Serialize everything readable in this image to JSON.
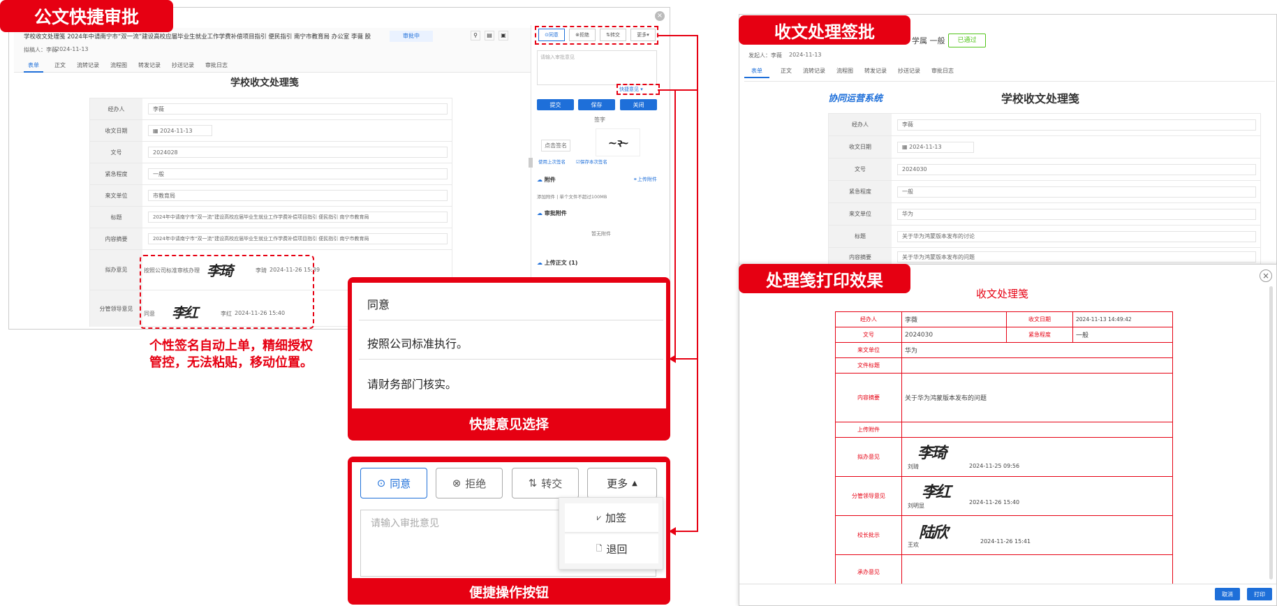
{
  "left": {
    "tag": "公文快捷审批",
    "header_title": "学校收文处理笺  2024年中请南宁市“双一流”建设高校应届毕业生就业工作学费补偿项目指引  便民指引  南宁市教育局  办公室  李薇  股",
    "status_badge": "审批中",
    "drafter_label": "拟稿人：李薇",
    "drafter_date": "2024-11-13",
    "tabs": [
      "表单",
      "正文",
      "流转记录",
      "流程图",
      "转发记录",
      "抄送记录",
      "审批日志"
    ],
    "form_title": "学校收文处理笺",
    "rows": [
      {
        "label": "经办人",
        "value": "李薇"
      },
      {
        "label": "收文日期",
        "value": "2024-11-13"
      },
      {
        "label": "文号",
        "value": "2024028"
      },
      {
        "label": "紧急程度",
        "value": "一般"
      },
      {
        "label": "来文单位",
        "value": "市教育局"
      },
      {
        "label": "标题",
        "value": "2024年中请南宁市“双一流”建设高校应届毕业生就业工作学费补偿项目指引  便民指引  南宁市教育局"
      },
      {
        "label": "内容摘要",
        "value": "2024年中请南宁市“双一流”建设高校应届毕业生就业工作学费补偿项目指引  便民指引  南宁市教育局"
      }
    ],
    "opinion1_label": "拟办意见",
    "opinion1_text": "按照公司标准审核办理",
    "opinion1_sig": "李琦",
    "opinion1_name": "李琦",
    "opinion1_time": "2024-11-26 15:39",
    "opinion2_label": "分管领导意见",
    "opinion2_text": "同意",
    "opinion2_sig": "李红",
    "opinion2_name": "李红",
    "opinion2_time": "2024-11-26 15:40",
    "side": {
      "btn_agree": "同意",
      "btn_reject": "拒绝",
      "btn_transfer": "转交",
      "btn_more": "更多",
      "opinion_placeholder": "请输入审批意见",
      "quick_opinion": "快捷意见",
      "btn_submit": "提交",
      "btn_save": "保存",
      "btn_close": "关闭",
      "sign_section": "签字",
      "sign_btn": "点击签名",
      "sign_link": "使用上次签名",
      "sign_check": "保存本次签名",
      "attach_title": "附件",
      "attach_upload": "上传附件",
      "attach_hint": "添加附件 | 单个文件不超过100MB",
      "approval_attach": "审批附件",
      "no_attach": "暂无附件",
      "upload_body": "上传正文 (1)"
    },
    "caption": "个性签名自动上单，精细授权管控，无法粘贴，移动位置。"
  },
  "quick_opinions": {
    "items": [
      "同意",
      "按照公司标准执行。",
      "请财务部门核实。"
    ],
    "footer": "快捷意见选择"
  },
  "quick_actions": {
    "agree": "同意",
    "reject": "拒绝",
    "transfer": "转交",
    "more": "更多",
    "placeholder": "请输入审批意见",
    "menu_add_sign": "加签",
    "menu_return": "退回",
    "footer": "便捷操作按钮"
  },
  "right_top": {
    "tag": "收文处理签批",
    "header_tail": "学属  一般",
    "status": "已通过",
    "drafter": "发起人：李薇",
    "drafter_date": "2024-11-13",
    "tabs": [
      "表单",
      "正文",
      "流转记录",
      "流程图",
      "转发记录",
      "抄送记录",
      "审批日志"
    ],
    "logo": "协同运营系统",
    "form_title": "学校收文处理笺",
    "rows": [
      {
        "label": "经办人",
        "value": "李薇"
      },
      {
        "label": "收文日期",
        "value": "2024-11-13"
      },
      {
        "label": "文号",
        "value": "2024030"
      },
      {
        "label": "紧急程度",
        "value": "一般"
      },
      {
        "label": "来文单位",
        "value": "华为"
      },
      {
        "label": "标题",
        "value": "关于华为鸿蒙版本发布的讨论"
      },
      {
        "label": "内容摘要",
        "value": "关于华为鸿蒙版本发布的问题"
      }
    ]
  },
  "right_bottom": {
    "tag": "处理笺打印效果",
    "title": "收文处理笺",
    "r1": {
      "l1": "经办人",
      "v1": "李薇",
      "l2": "收文日期",
      "v2": "2024-11-13 14:49:42"
    },
    "r2": {
      "l1": "文号",
      "v1": "2024030",
      "l2": "紧急程度",
      "v2": "一般"
    },
    "r3": {
      "l": "来文单位",
      "v": "华为"
    },
    "r4": {
      "l": "文件标题",
      "v": ""
    },
    "r5": {
      "l": "内容摘要",
      "v": "关于华为鸿蒙版本发布的问题"
    },
    "r6": {
      "l": "上传附件",
      "v": ""
    },
    "r7": {
      "l": "拟办意见",
      "name": "刘琦",
      "time": "2024-11-25 09:56",
      "sig": "李琦"
    },
    "r8": {
      "l": "分管领导意见",
      "name": "刘明显",
      "time": "2024-11-26 15:40",
      "sig": "李红"
    },
    "r9": {
      "l": "校长批示",
      "name": "王欢",
      "time": "2024-11-26 15:41",
      "sig": "陆欣"
    },
    "r10": {
      "l": "承办意见",
      "v": ""
    },
    "btn_cancel": "取消",
    "btn_print": "打印"
  },
  "colors": {
    "accent_red": "#e60012",
    "blue": "#1e6fd9"
  }
}
